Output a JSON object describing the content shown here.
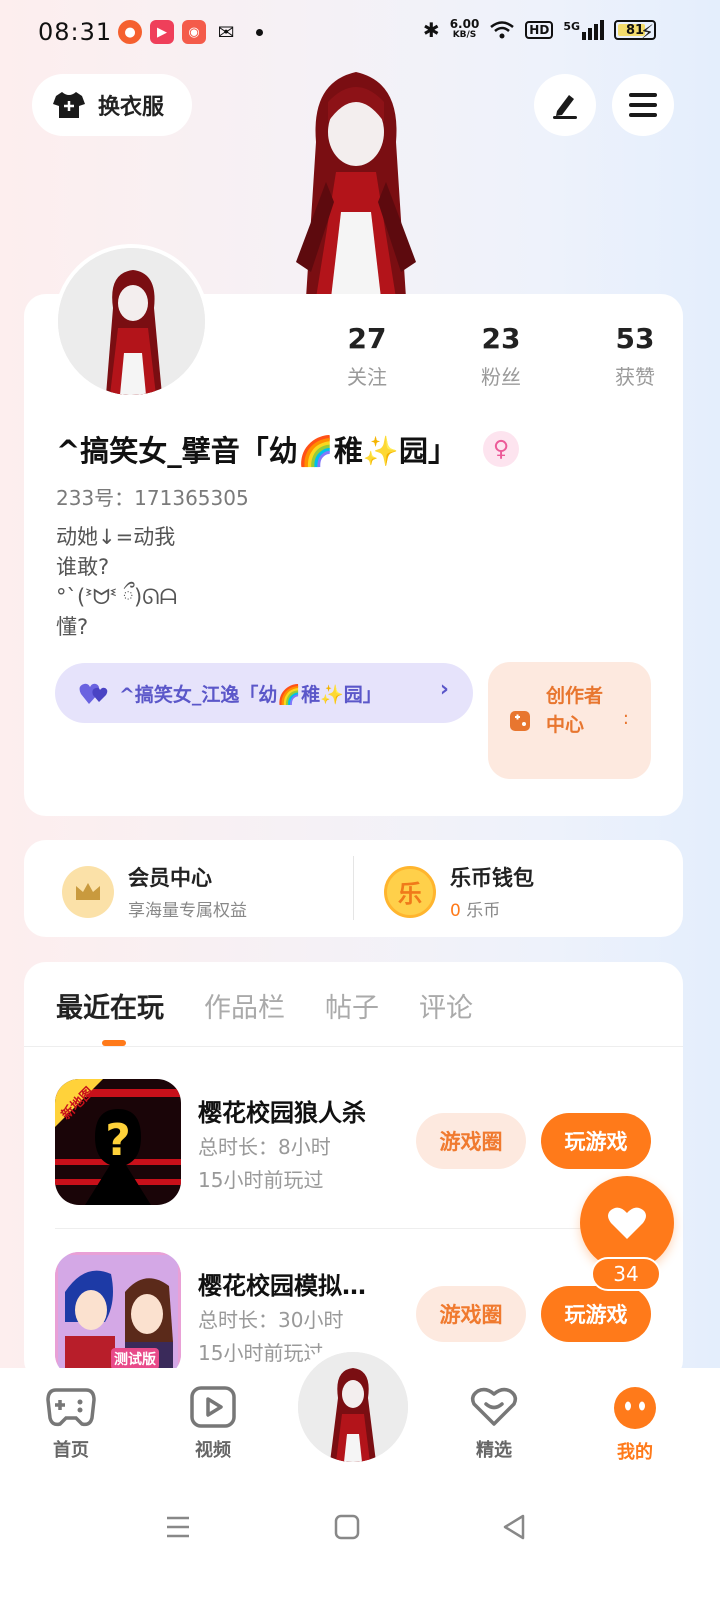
{
  "status_bar": {
    "time": "08:31",
    "net_speed_value": "6.00",
    "net_speed_unit": "KB/S",
    "hd": "HD",
    "signal": "5G",
    "battery": "81",
    "battery_level": 0.81
  },
  "header": {
    "wardrobe_label": "换衣服"
  },
  "profile": {
    "stats": [
      {
        "value": "27",
        "label": "关注"
      },
      {
        "value": "23",
        "label": "粉丝"
      },
      {
        "value": "53",
        "label": "获赞"
      }
    ],
    "nickname": "^搞笑女_擘音「幼🌈稚✨园」",
    "gender_symbol": "♀",
    "uid": "233号：171365305",
    "bio_lines": [
      "动她↓=动我",
      "谁敢?",
      "°ˋ(ᕑᗢᓫ ྀ)ᘏᗩ",
      "懂?"
    ],
    "couple_name": "^搞笑女_江逸「幼🌈稚✨园」",
    "creator_label": "创作者中心",
    "creator_colon": ":"
  },
  "member": {
    "vip_title": "会员中心",
    "vip_sub": "享海量专属权益",
    "wallet_title": "乐币钱包",
    "wallet_amount": "0",
    "wallet_unit": "乐币",
    "wallet_icon_char": "乐"
  },
  "tabs": [
    "最近在玩",
    "作品栏",
    "帖子",
    "评论"
  ],
  "games": [
    {
      "title": "樱花校园狼人杀",
      "duration": "总时长：8小时",
      "last_played": "15小时前玩过",
      "badge": "新地图",
      "circle_label": "游戏圈",
      "play_label": "玩游戏"
    },
    {
      "title": "樱花校园模拟…",
      "duration": "总时长：30小时",
      "last_played": "15小时前玩过",
      "badge": "测试版",
      "circle_label": "游戏圈",
      "play_label": "玩游戏"
    }
  ],
  "like": {
    "count": "34"
  },
  "bottom_nav": {
    "items": [
      {
        "label": "首页"
      },
      {
        "label": "视频"
      },
      {
        "label": "精选"
      },
      {
        "label": "我的"
      }
    ]
  },
  "colors": {
    "accent": "#ff7a1a",
    "couple": "#5b57c9",
    "creator_bg": "#fde9df"
  }
}
